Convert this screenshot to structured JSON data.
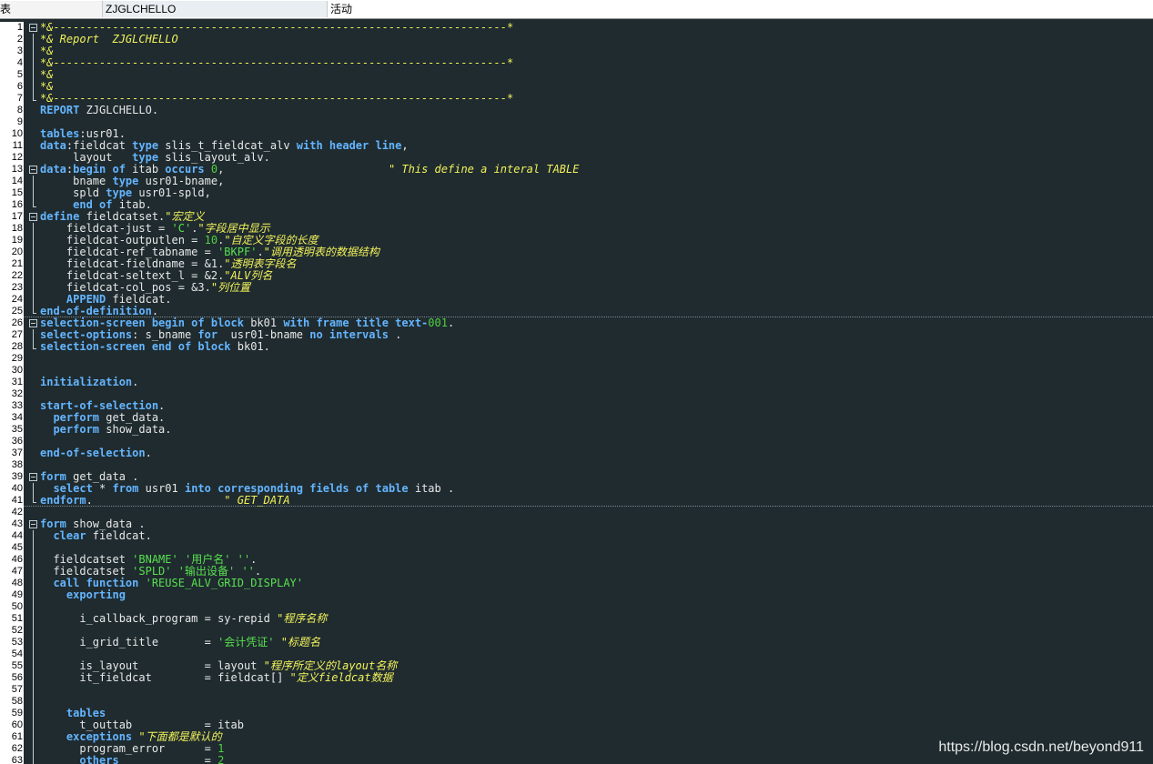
{
  "header": {
    "col1": "表",
    "program": "ZJGLCHELLO",
    "status": "活动"
  },
  "watermark": "https://blog.csdn.net/beyond911",
  "token_colors": {
    "plain": "#e8e8e8",
    "keyword": "#64b5ff",
    "string": "#58e04f",
    "number": "#50d040",
    "comment": "#f2f25a"
  },
  "lines": [
    {
      "n": "1",
      "fold": "box",
      "sep": false,
      "t": [
        [
          "c",
          "*&---------------------------------------------------------------------*"
        ]
      ]
    },
    {
      "n": "2",
      "fold": "bar",
      "sep": false,
      "t": [
        [
          "c",
          "*& Report  ZJGLCHELLO"
        ]
      ]
    },
    {
      "n": "3",
      "fold": "bar",
      "sep": false,
      "t": [
        [
          "c",
          "*&"
        ]
      ]
    },
    {
      "n": "4",
      "fold": "bar",
      "sep": false,
      "t": [
        [
          "c",
          "*&---------------------------------------------------------------------*"
        ]
      ]
    },
    {
      "n": "5",
      "fold": "bar",
      "sep": false,
      "t": [
        [
          "c",
          "*&"
        ]
      ]
    },
    {
      "n": "6",
      "fold": "bar",
      "sep": false,
      "t": [
        [
          "c",
          "*&"
        ]
      ]
    },
    {
      "n": "7",
      "fold": "end",
      "sep": false,
      "t": [
        [
          "c",
          "*&---------------------------------------------------------------------*"
        ]
      ]
    },
    {
      "n": "8",
      "fold": "",
      "sep": false,
      "t": [
        [
          "k",
          "REPORT"
        ],
        [
          "p",
          " ZJGLCHELLO."
        ]
      ]
    },
    {
      "n": "9",
      "fold": "",
      "sep": false,
      "t": []
    },
    {
      "n": "10",
      "fold": "",
      "sep": false,
      "t": [
        [
          "k",
          "tables"
        ],
        [
          "p",
          ":usr01."
        ]
      ]
    },
    {
      "n": "11",
      "fold": "",
      "sep": false,
      "t": [
        [
          "k",
          "data"
        ],
        [
          "p",
          ":fieldcat "
        ],
        [
          "k",
          "type"
        ],
        [
          "p",
          " slis_t_fieldcat_alv "
        ],
        [
          "k",
          "with header line"
        ],
        [
          "p",
          ","
        ]
      ]
    },
    {
      "n": "12",
      "fold": "",
      "sep": false,
      "t": [
        [
          "p",
          "     layout   "
        ],
        [
          "k",
          "type"
        ],
        [
          "p",
          " slis_layout_alv."
        ]
      ]
    },
    {
      "n": "13",
      "fold": "box",
      "sep": false,
      "t": [
        [
          "k",
          "data"
        ],
        [
          "p",
          ":"
        ],
        [
          "k",
          "begin of"
        ],
        [
          "p",
          " itab "
        ],
        [
          "k",
          "occurs"
        ],
        [
          "p",
          " "
        ],
        [
          "n",
          "0"
        ],
        [
          "p",
          ",                         "
        ],
        [
          "c",
          "\" This define a interal TABLE"
        ]
      ]
    },
    {
      "n": "14",
      "fold": "bar",
      "sep": false,
      "t": [
        [
          "p",
          "     bname "
        ],
        [
          "k",
          "type"
        ],
        [
          "p",
          " usr01-bname,"
        ]
      ]
    },
    {
      "n": "15",
      "fold": "bar",
      "sep": false,
      "t": [
        [
          "p",
          "     spld "
        ],
        [
          "k",
          "type"
        ],
        [
          "p",
          " usr01-spld,"
        ]
      ]
    },
    {
      "n": "16",
      "fold": "end",
      "sep": false,
      "t": [
        [
          "p",
          "     "
        ],
        [
          "k",
          "end of"
        ],
        [
          "p",
          " itab."
        ]
      ]
    },
    {
      "n": "17",
      "fold": "box",
      "sep": false,
      "t": [
        [
          "k",
          "define"
        ],
        [
          "p",
          " fieldcatset."
        ],
        [
          "c",
          "\"宏定义"
        ]
      ]
    },
    {
      "n": "18",
      "fold": "bar",
      "sep": false,
      "t": [
        [
          "p",
          "    fieldcat-just = "
        ],
        [
          "s",
          "'C'"
        ],
        [
          "p",
          "."
        ],
        [
          "c",
          "\"字段居中显示"
        ]
      ]
    },
    {
      "n": "19",
      "fold": "bar",
      "sep": false,
      "t": [
        [
          "p",
          "    fieldcat-outputlen = "
        ],
        [
          "n",
          "10"
        ],
        [
          "p",
          "."
        ],
        [
          "c",
          "\"自定义字段的长度"
        ]
      ]
    },
    {
      "n": "20",
      "fold": "bar",
      "sep": false,
      "t": [
        [
          "p",
          "    fieldcat-ref_tabname = "
        ],
        [
          "s",
          "'BKPF'"
        ],
        [
          "p",
          "."
        ],
        [
          "c",
          "\"调用透明表的数据结构"
        ]
      ]
    },
    {
      "n": "21",
      "fold": "bar",
      "sep": false,
      "t": [
        [
          "p",
          "    fieldcat-fieldname = &1."
        ],
        [
          "c",
          "\"透明表字段名"
        ]
      ]
    },
    {
      "n": "22",
      "fold": "bar",
      "sep": false,
      "t": [
        [
          "p",
          "    fieldcat-seltext_l = &2."
        ],
        [
          "c",
          "\"ALV列名"
        ]
      ]
    },
    {
      "n": "23",
      "fold": "bar",
      "sep": false,
      "t": [
        [
          "p",
          "    fieldcat-col_pos = &3."
        ],
        [
          "c",
          "\"列位置"
        ]
      ]
    },
    {
      "n": "24",
      "fold": "bar",
      "sep": false,
      "t": [
        [
          "p",
          "    "
        ],
        [
          "k",
          "APPEND"
        ],
        [
          "p",
          " fieldcat."
        ]
      ]
    },
    {
      "n": "25",
      "fold": "end",
      "sep": true,
      "t": [
        [
          "k",
          "end-of-definition"
        ],
        [
          "p",
          "."
        ]
      ]
    },
    {
      "n": "26",
      "fold": "box",
      "sep": false,
      "t": [
        [
          "k",
          "selection-screen begin of block"
        ],
        [
          "p",
          " bk01 "
        ],
        [
          "k",
          "with frame title"
        ],
        [
          "p",
          " "
        ],
        [
          "k",
          "text-"
        ],
        [
          "n",
          "001"
        ],
        [
          "p",
          "."
        ]
      ]
    },
    {
      "n": "27",
      "fold": "bar",
      "sep": false,
      "t": [
        [
          "k",
          "select-options"
        ],
        [
          "p",
          ": s_bname "
        ],
        [
          "k",
          "for"
        ],
        [
          "p",
          "  usr01-bname "
        ],
        [
          "k",
          "no intervals"
        ],
        [
          "p",
          " ."
        ]
      ]
    },
    {
      "n": "28",
      "fold": "end",
      "sep": false,
      "t": [
        [
          "k",
          "selection-screen end of block"
        ],
        [
          "p",
          " bk01."
        ]
      ]
    },
    {
      "n": "29",
      "fold": "",
      "sep": false,
      "t": []
    },
    {
      "n": "30",
      "fold": "",
      "sep": false,
      "t": []
    },
    {
      "n": "31",
      "fold": "",
      "sep": false,
      "t": [
        [
          "k",
          "initialization"
        ],
        [
          "p",
          "."
        ]
      ]
    },
    {
      "n": "32",
      "fold": "",
      "sep": false,
      "t": []
    },
    {
      "n": "33",
      "fold": "",
      "sep": false,
      "t": [
        [
          "k",
          "start-of-selection"
        ],
        [
          "p",
          "."
        ]
      ]
    },
    {
      "n": "34",
      "fold": "",
      "sep": false,
      "t": [
        [
          "p",
          "  "
        ],
        [
          "k",
          "perform"
        ],
        [
          "p",
          " get_data."
        ]
      ]
    },
    {
      "n": "35",
      "fold": "",
      "sep": false,
      "t": [
        [
          "p",
          "  "
        ],
        [
          "k",
          "perform"
        ],
        [
          "p",
          " show_data."
        ]
      ]
    },
    {
      "n": "36",
      "fold": "",
      "sep": false,
      "t": []
    },
    {
      "n": "37",
      "fold": "",
      "sep": false,
      "t": [
        [
          "k",
          "end-of-selection"
        ],
        [
          "p",
          "."
        ]
      ]
    },
    {
      "n": "38",
      "fold": "",
      "sep": false,
      "t": []
    },
    {
      "n": "39",
      "fold": "box",
      "sep": false,
      "t": [
        [
          "k",
          "form"
        ],
        [
          "p",
          " get_data ."
        ]
      ]
    },
    {
      "n": "40",
      "fold": "bar",
      "sep": false,
      "t": [
        [
          "p",
          "  "
        ],
        [
          "k",
          "select"
        ],
        [
          "p",
          " * "
        ],
        [
          "k",
          "from"
        ],
        [
          "p",
          " usr01 "
        ],
        [
          "k",
          "into corresponding fields of table"
        ],
        [
          "p",
          " itab ."
        ]
      ]
    },
    {
      "n": "41",
      "fold": "end",
      "sep": true,
      "t": [
        [
          "k",
          "endform"
        ],
        [
          "p",
          ".                    "
        ],
        [
          "c",
          "\" GET_DATA"
        ]
      ]
    },
    {
      "n": "42",
      "fold": "",
      "sep": false,
      "t": []
    },
    {
      "n": "43",
      "fold": "box",
      "sep": false,
      "t": [
        [
          "k",
          "form"
        ],
        [
          "p",
          " show_data ."
        ]
      ]
    },
    {
      "n": "44",
      "fold": "bar",
      "sep": false,
      "t": [
        [
          "p",
          "  "
        ],
        [
          "k",
          "clear"
        ],
        [
          "p",
          " fieldcat."
        ]
      ]
    },
    {
      "n": "45",
      "fold": "bar",
      "sep": false,
      "t": []
    },
    {
      "n": "46",
      "fold": "bar",
      "sep": false,
      "t": [
        [
          "p",
          "  fieldcatset "
        ],
        [
          "s",
          "'BNAME'"
        ],
        [
          "p",
          " "
        ],
        [
          "s",
          "'用户名'"
        ],
        [
          "p",
          " "
        ],
        [
          "s",
          "''"
        ],
        [
          "p",
          "."
        ]
      ]
    },
    {
      "n": "47",
      "fold": "bar",
      "sep": false,
      "t": [
        [
          "p",
          "  fieldcatset "
        ],
        [
          "s",
          "'SPLD'"
        ],
        [
          "p",
          " "
        ],
        [
          "s",
          "'输出设备'"
        ],
        [
          "p",
          " "
        ],
        [
          "s",
          "''"
        ],
        [
          "p",
          "."
        ]
      ]
    },
    {
      "n": "48",
      "fold": "bar",
      "sep": false,
      "t": [
        [
          "p",
          "  "
        ],
        [
          "k",
          "call function"
        ],
        [
          "p",
          " "
        ],
        [
          "s",
          "'REUSE_ALV_GRID_DISPLAY'"
        ]
      ]
    },
    {
      "n": "49",
      "fold": "bar",
      "sep": false,
      "t": [
        [
          "p",
          "    "
        ],
        [
          "k",
          "exporting"
        ]
      ]
    },
    {
      "n": "50",
      "fold": "bar",
      "sep": false,
      "t": []
    },
    {
      "n": "51",
      "fold": "bar",
      "sep": false,
      "t": [
        [
          "p",
          "      i_callback_program = sy-repid "
        ],
        [
          "c",
          "\"程序名称"
        ]
      ]
    },
    {
      "n": "52",
      "fold": "bar",
      "sep": false,
      "t": []
    },
    {
      "n": "53",
      "fold": "bar",
      "sep": false,
      "t": [
        [
          "p",
          "      i_grid_title       = "
        ],
        [
          "s",
          "'会计凭证'"
        ],
        [
          "p",
          " "
        ],
        [
          "c",
          "\"标题名"
        ]
      ]
    },
    {
      "n": "54",
      "fold": "bar",
      "sep": false,
      "t": []
    },
    {
      "n": "55",
      "fold": "bar",
      "sep": false,
      "t": [
        [
          "p",
          "      is_layout          = layout "
        ],
        [
          "c",
          "\"程序所定义的layout名称"
        ]
      ]
    },
    {
      "n": "56",
      "fold": "bar",
      "sep": false,
      "t": [
        [
          "p",
          "      it_fieldcat        = fieldcat[] "
        ],
        [
          "c",
          "\"定义fieldcat数据"
        ]
      ]
    },
    {
      "n": "57",
      "fold": "bar",
      "sep": false,
      "t": []
    },
    {
      "n": "58",
      "fold": "bar",
      "sep": false,
      "t": []
    },
    {
      "n": "59",
      "fold": "bar",
      "sep": false,
      "t": [
        [
          "p",
          "    "
        ],
        [
          "k",
          "tables"
        ]
      ]
    },
    {
      "n": "60",
      "fold": "bar",
      "sep": false,
      "t": [
        [
          "p",
          "      t_outtab           = itab"
        ]
      ]
    },
    {
      "n": "61",
      "fold": "bar",
      "sep": false,
      "t": [
        [
          "p",
          "    "
        ],
        [
          "k",
          "exceptions"
        ],
        [
          "p",
          " "
        ],
        [
          "c",
          "\"下面都是默认的"
        ]
      ]
    },
    {
      "n": "62",
      "fold": "bar",
      "sep": false,
      "t": [
        [
          "p",
          "      program_error      = "
        ],
        [
          "n",
          "1"
        ]
      ]
    },
    {
      "n": "63",
      "fold": "bar",
      "sep": false,
      "t": [
        [
          "p",
          "      "
        ],
        [
          "k",
          "others"
        ],
        [
          "p",
          "             = "
        ],
        [
          "n",
          "2"
        ]
      ]
    }
  ]
}
